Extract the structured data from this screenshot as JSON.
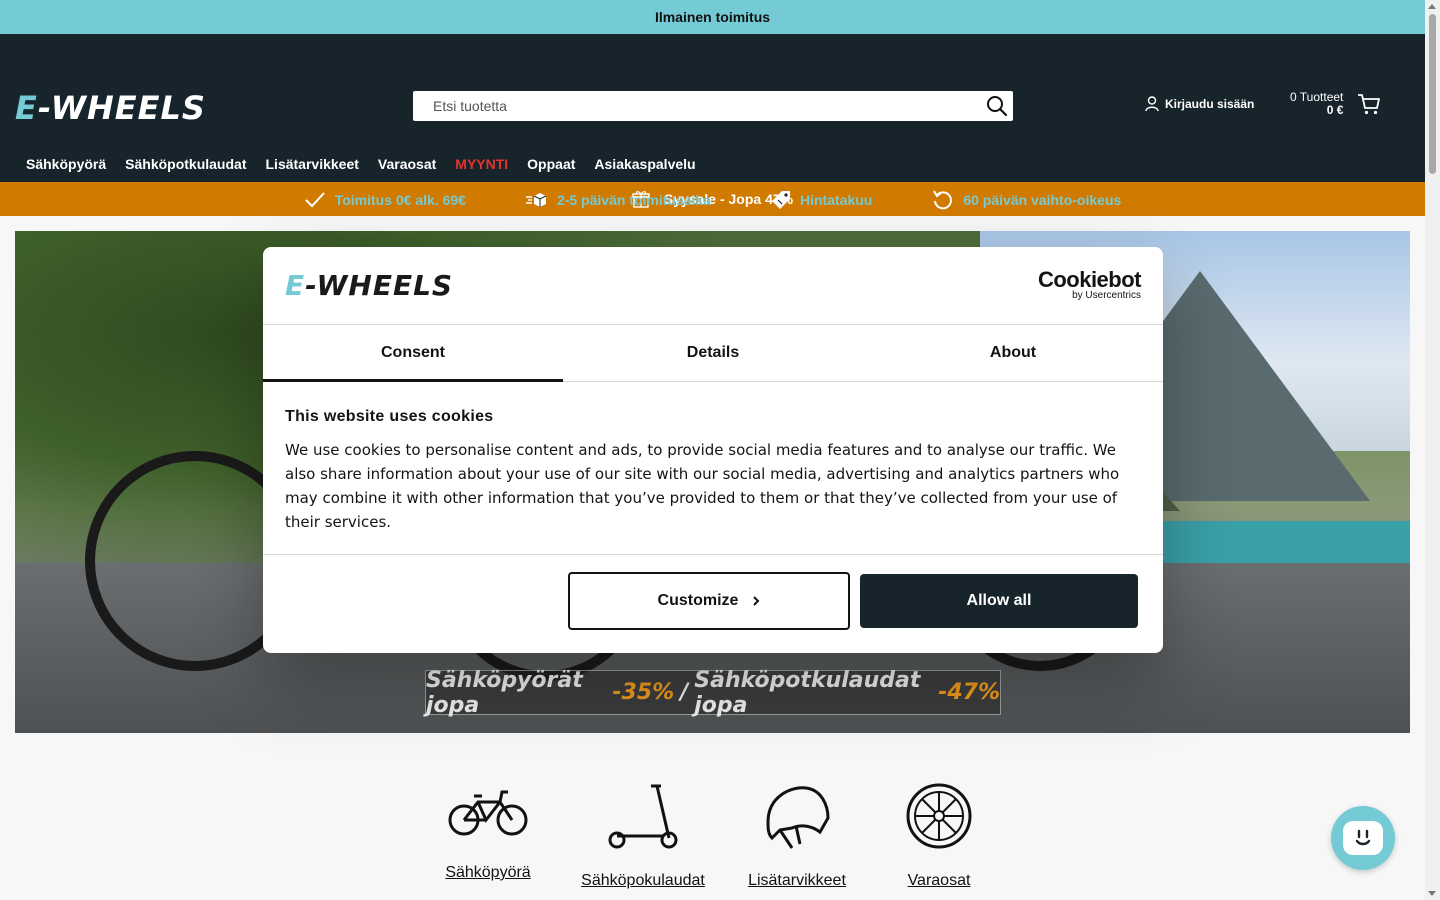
{
  "topbar": {
    "text": "Ilmainen toimitus"
  },
  "header": {
    "logo_text": "-WHEELS",
    "logo_letter": "E",
    "search_placeholder": "Etsi tuotetta",
    "login_label": "Kirjaudu sisään",
    "cart_count": "0 Tuotteet",
    "cart_amount": "0 €"
  },
  "nav": {
    "items": [
      "Sähköpyörä",
      "Sähköpotkulaudat",
      "Lisätarvikkeet",
      "Varaosat",
      "MYYNTI",
      "Oppaat",
      "Asiakaspalvelu"
    ]
  },
  "usp": {
    "items": [
      "Toimitus 0€ alk. 69€",
      "2-5 päivän toimitusaika",
      "Hintatakuu",
      "60 päivän vaihto-oikeus"
    ]
  },
  "promo": {
    "text": "Syysale - Jopa 47%"
  },
  "hero": {
    "banner_part1": "Sähköpyörät jopa",
    "banner_pct1": "-35%",
    "banner_sep": "/",
    "banner_part2": "Sähköpotkulaudat jopa",
    "banner_pct2": "-47%"
  },
  "categories": [
    {
      "label": "Sähköpyörä",
      "icon": "bicycle-icon"
    },
    {
      "label": "Sähköpokulaudat",
      "icon": "scooter-icon"
    },
    {
      "label": "Lisätarvikkeet",
      "icon": "helmet-icon"
    },
    {
      "label": "Varaosat",
      "icon": "wheel-icon"
    }
  ],
  "cookie_dialog": {
    "logo_text": "-WHEELS",
    "logo_letter": "E",
    "brand": "Cookiebot",
    "brand_sub": "by Usercentrics",
    "tabs": [
      "Consent",
      "Details",
      "About"
    ],
    "active_tab": "Consent",
    "title": "This website uses cookies",
    "body": "We use cookies to personalise content and ads, to provide social media features and to analyse our traffic. We also share information about your use of our site with our social media, advertising and analytics partners who may combine it with other information that you’ve provided to them or that they’ve collected from your use of their services.",
    "customize_label": "Customize",
    "allow_label": "Allow all"
  },
  "colors": {
    "accent": "#74cbd5",
    "header_bg": "#17242b",
    "promo_bg": "#d07a00",
    "sale_red": "#e9322a"
  }
}
